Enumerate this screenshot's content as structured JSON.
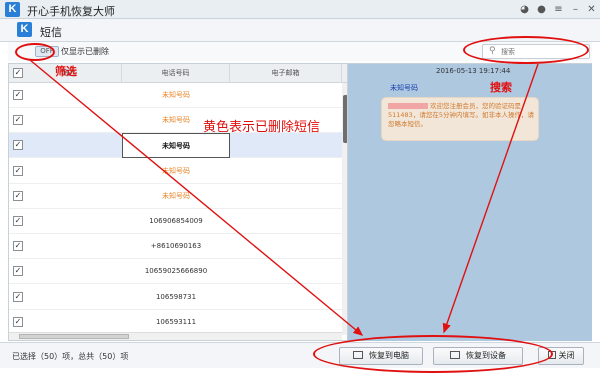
{
  "titlebar": {
    "logo": "K",
    "title": "开心手机恢复大师"
  },
  "window": {
    "logo": "K",
    "title": "短信"
  },
  "toolbar": {
    "filter_toggle": "OFF",
    "filter_label": "仅显示已删除",
    "search_placeholder": "搜索"
  },
  "table": {
    "headers": [
      "筛选",
      "电话号码",
      "电子邮箱"
    ],
    "rows": [
      {
        "phone": "未知号码",
        "deleted": true
      },
      {
        "phone": "未知号码",
        "deleted": true
      },
      {
        "phone": "未知号码",
        "deleted": false,
        "selected": true
      },
      {
        "phone": "未知号码",
        "deleted": true
      },
      {
        "phone": "未知号码",
        "deleted": true
      },
      {
        "phone": "106906854009",
        "deleted": false
      },
      {
        "phone": "+8610690163",
        "deleted": false
      },
      {
        "phone": "10659025666890",
        "deleted": false
      },
      {
        "phone": "106598731",
        "deleted": false
      },
      {
        "phone": "106593111",
        "deleted": false
      }
    ]
  },
  "message": {
    "time": "2016-05-13 19:17:44",
    "sender": "未知号码",
    "text": "欢迎您注册会员，您的验证码是511483，请您在5分钟内填写。如非本人操作，请忽略本短信。"
  },
  "status": {
    "text": "已选择（50）项，总共（50）项"
  },
  "buttons": {
    "restore_pc": "恢复到电脑",
    "restore_device": "恢复到设备",
    "close": "关闭"
  },
  "annotations": {
    "filter": "筛选",
    "deleted_note": "黄色表示已删除短信",
    "search": "搜索"
  },
  "colors": {
    "deleted": "#e8862a",
    "annotation": "#e01010",
    "message_pane": "#aec8e0"
  }
}
